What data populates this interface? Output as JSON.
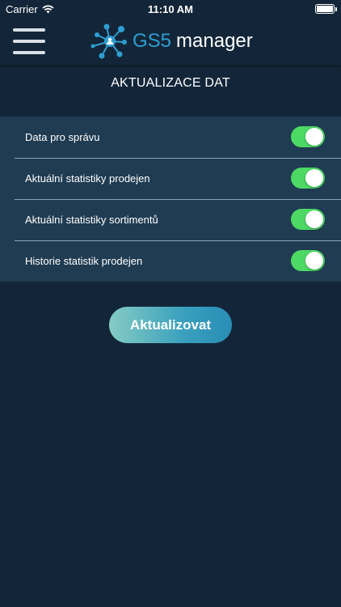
{
  "status_bar": {
    "carrier": "Carrier",
    "time": "11:10 AM",
    "icons": [
      "wifi-icon",
      "battery-icon"
    ]
  },
  "nav": {
    "menu_icon": "hamburger-menu-icon",
    "brand_gs5": "GS5",
    "brand_manager": "manager"
  },
  "page": {
    "title": "AKTUALIZACE DAT"
  },
  "settings": {
    "items": [
      {
        "label": "Data pro správu",
        "enabled": true
      },
      {
        "label": "Aktuální statistiky prodejen",
        "enabled": true
      },
      {
        "label": "Aktuální statistiky sortimentů",
        "enabled": true
      },
      {
        "label": "Historie statistik prodejen",
        "enabled": true
      }
    ]
  },
  "actions": {
    "update_label": "Aktualizovat"
  },
  "colors": {
    "background": "#132639",
    "list_background": "#203c52",
    "toggle_on": "#4cd964",
    "brand_blue": "#2e9ed1",
    "button_gradient_start": "#86ccc3",
    "button_gradient_end": "#2a8db6"
  }
}
